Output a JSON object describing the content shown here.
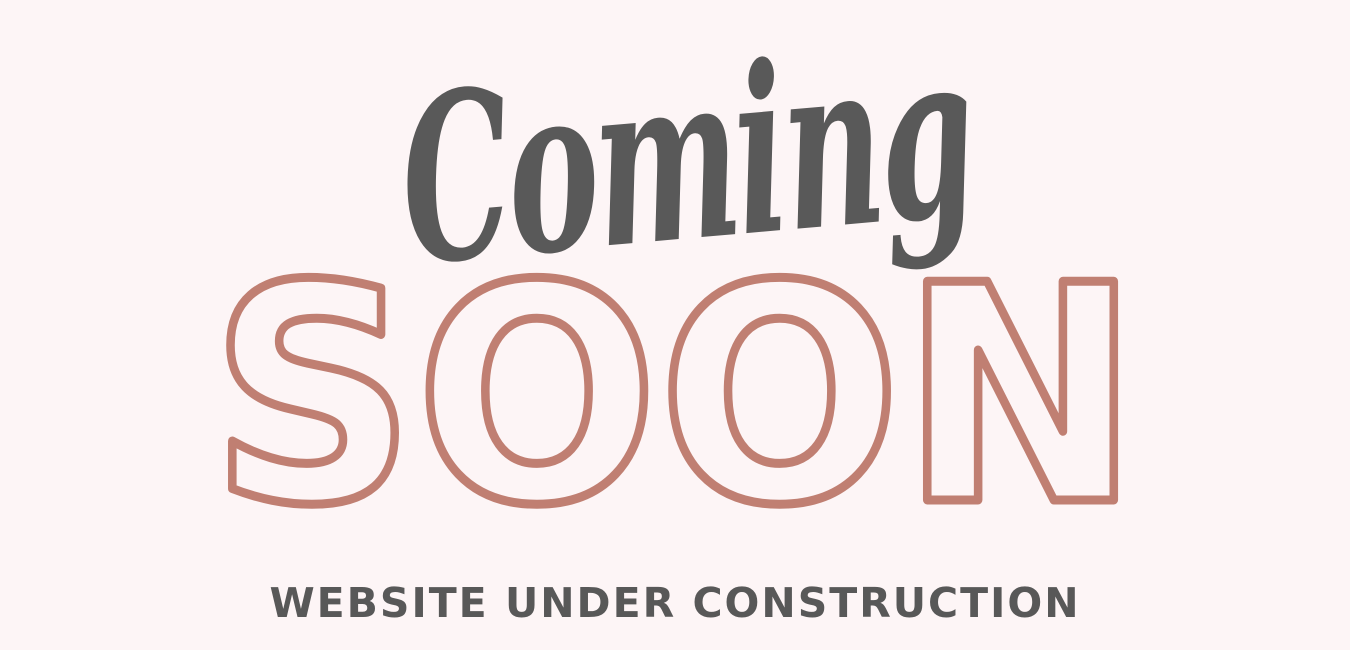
{
  "hero": {
    "script_word": "Coming",
    "outline_word": "SOON",
    "subtitle": "WEBSITE UNDER CONSTRUCTION"
  },
  "colors": {
    "background": "#fdf5f6",
    "script_text": "#595959",
    "outline_text": "#c07f72",
    "subtitle_text": "#585858"
  }
}
